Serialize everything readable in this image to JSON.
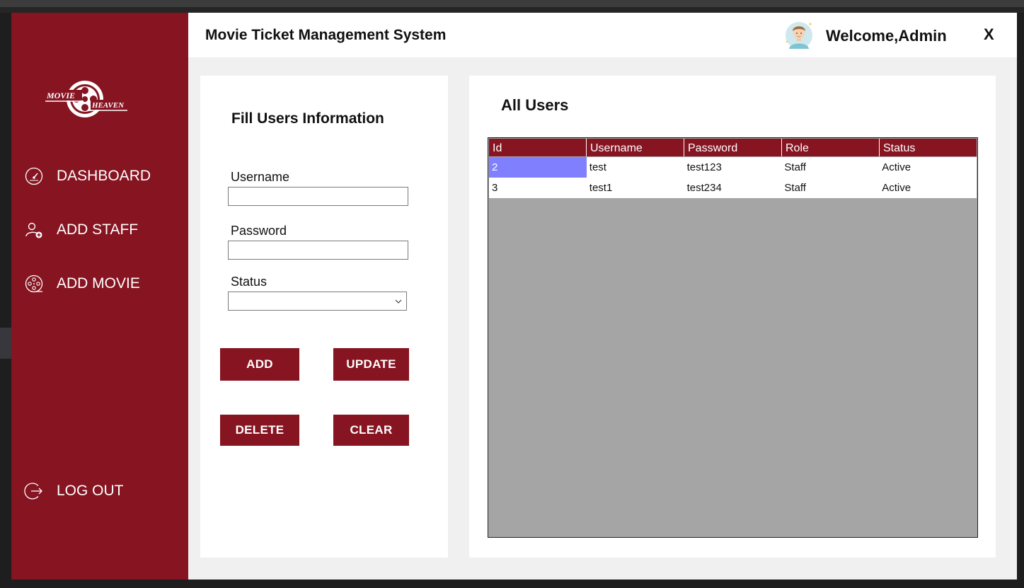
{
  "app": {
    "title": "Movie Ticket Management System",
    "welcome": "Welcome,Admin",
    "close_label": "X",
    "brand": {
      "line1": "MOVIE",
      "line2": "HEAVEN"
    },
    "colors": {
      "accent": "#861421",
      "selection": "#8080ff",
      "grid_bg": "#a5a5a5"
    }
  },
  "sidebar": {
    "items": [
      {
        "label": "DASHBOARD",
        "icon": "gauge-icon"
      },
      {
        "label": "ADD STAFF",
        "icon": "add-user-icon"
      },
      {
        "label": "ADD MOVIE",
        "icon": "film-reel-icon"
      }
    ],
    "logout": {
      "label": "LOG OUT",
      "icon": "logout-icon"
    }
  },
  "form": {
    "title": "Fill Users Information",
    "username": {
      "label": "Username",
      "value": ""
    },
    "password": {
      "label": "Password",
      "value": ""
    },
    "status": {
      "label": "Status",
      "value": ""
    },
    "buttons": {
      "add": "ADD",
      "update": "UPDATE",
      "delete": "DELETE",
      "clear": "CLEAR"
    }
  },
  "users": {
    "title": "All Users",
    "columns": [
      "Id",
      "Username",
      "Password",
      "Role",
      "Status"
    ],
    "rows": [
      [
        "2",
        "test",
        "test123",
        "Staff",
        "Active"
      ],
      [
        "3",
        "test1",
        "test234",
        "Staff",
        "Active"
      ]
    ]
  }
}
